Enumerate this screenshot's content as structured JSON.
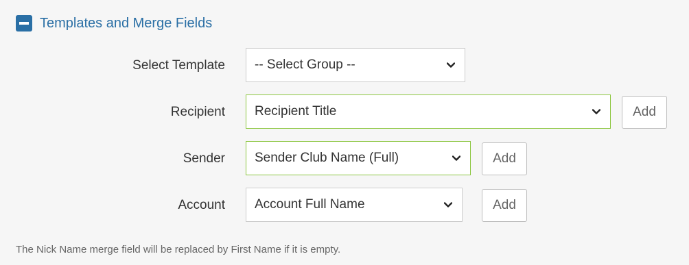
{
  "section": {
    "title": "Templates and Merge Fields"
  },
  "rows": {
    "template": {
      "label": "Select Template",
      "value": "-- Select Group --"
    },
    "recipient": {
      "label": "Recipient",
      "value": "Recipient Title",
      "add_label": "Add"
    },
    "sender": {
      "label": "Sender",
      "value": "Sender Club Name (Full)",
      "add_label": "Add"
    },
    "account": {
      "label": "Account",
      "value": "Account Full Name",
      "add_label": "Add"
    }
  },
  "footnote": "The Nick Name merge field will be replaced by First Name if it is empty.",
  "colors": {
    "accent": "#2a6fa5",
    "focus_border": "#8cc63f",
    "panel_bg": "#f6f6f6"
  },
  "icons": {
    "collapse": "minus-square-icon",
    "dropdown": "chevron-down-icon"
  }
}
